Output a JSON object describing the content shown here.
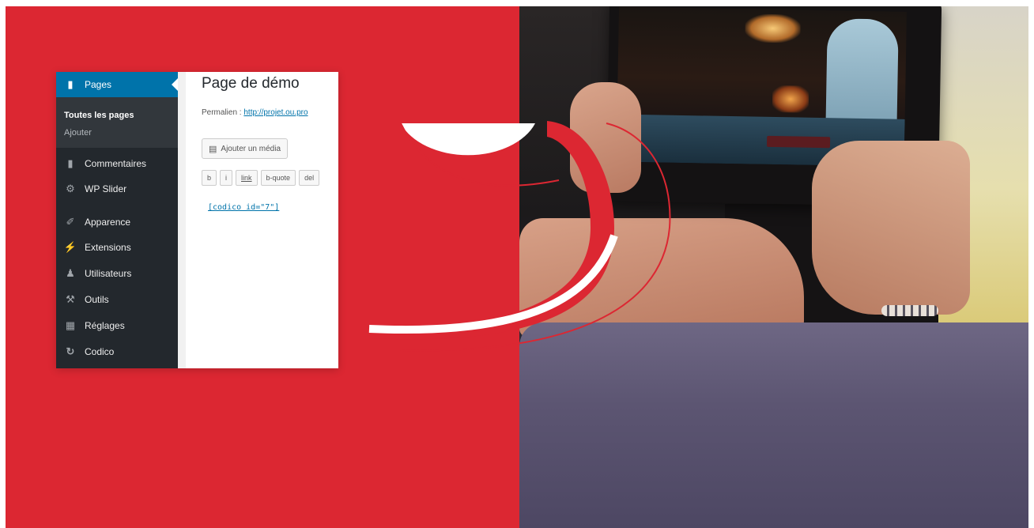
{
  "wp_admin": {
    "menu": [
      {
        "label": "Pages",
        "icon": "pages-icon",
        "active": true
      },
      {
        "label": "Commentaires",
        "icon": "comments-icon"
      },
      {
        "label": "WP Slider",
        "icon": "gear-icon"
      },
      {
        "label": "Apparence",
        "icon": "paintbrush-icon"
      },
      {
        "label": "Extensions",
        "icon": "plugin-icon"
      },
      {
        "label": "Utilisateurs",
        "icon": "user-icon"
      },
      {
        "label": "Outils",
        "icon": "wrench-icon"
      },
      {
        "label": "Réglages",
        "icon": "settings-icon"
      },
      {
        "label": "Codico",
        "icon": "codico-logo-icon"
      }
    ],
    "submenu": {
      "all_pages": "Toutes les pages",
      "add": "Ajouter"
    },
    "editor": {
      "page_title": "Page de démo",
      "permalink_label": "Permalien :",
      "permalink_url": "http://projet.ou.pro",
      "add_media": "Ajouter un média",
      "toolbar": [
        "b",
        "i",
        "link",
        "b-quote",
        "del"
      ],
      "shortcode": "[codico id=\"7\"]"
    }
  },
  "colors": {
    "brand_red": "#dc2732",
    "wp_sidebar": "#23282d",
    "wp_active": "#0073aa"
  }
}
